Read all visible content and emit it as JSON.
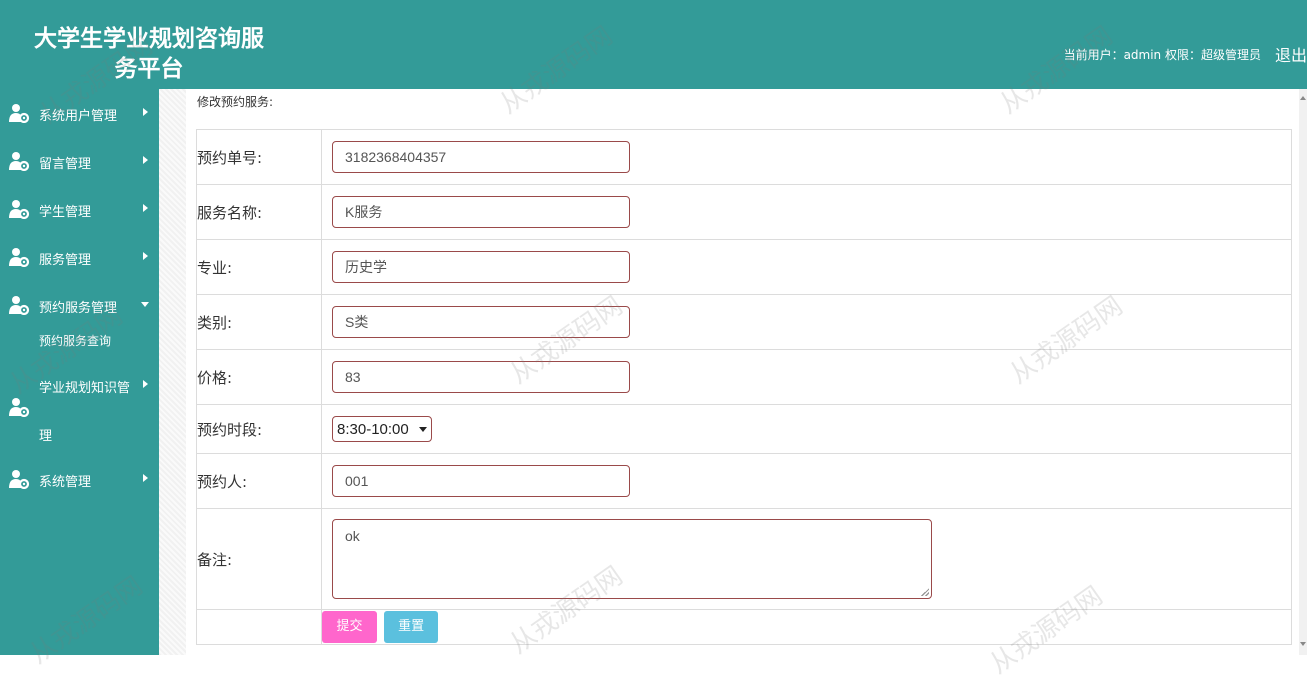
{
  "header": {
    "title_line1": "大学生学业规划咨询服",
    "title_line2": "务平台",
    "user_info": "当前用户：admin  权限：超级管理员",
    "logout": "退出"
  },
  "sidebar": {
    "items": [
      {
        "label": "系统用户管理",
        "icon": "user-gear-icon"
      },
      {
        "label": "留言管理",
        "icon": "user-gear-icon"
      },
      {
        "label": "学生管理",
        "icon": "user-gear-icon"
      },
      {
        "label": "服务管理",
        "icon": "user-gear-icon"
      },
      {
        "label": "预约服务管理",
        "icon": "user-gear-icon",
        "expanded": true,
        "children": [
          {
            "label": "预约服务查询"
          }
        ]
      },
      {
        "label": "学业规划知识管",
        "label_cont": "理",
        "icon": "user-gear-icon"
      },
      {
        "label": "系统管理",
        "icon": "user-gear-icon"
      }
    ]
  },
  "form": {
    "title": "修改预约服务:",
    "fields": {
      "order_no": {
        "label": "预约单号:",
        "value": "3182368404357"
      },
      "service_name": {
        "label": "服务名称:",
        "value": "K服务"
      },
      "major": {
        "label": "专业:",
        "value": "历史学"
      },
      "category": {
        "label": "类别:",
        "value": "S类"
      },
      "price": {
        "label": "价格:",
        "value": "83"
      },
      "time_slot": {
        "label": "预约时段:",
        "value": "8:30-10:00"
      },
      "booker": {
        "label": "预约人:",
        "value": "001"
      },
      "remark": {
        "label": "备注:",
        "value": "ok"
      }
    },
    "submit": "提交",
    "reset": "重置"
  },
  "watermark": "从戎源码网",
  "colors": {
    "header_bg": "#339b98",
    "sidebar_bg": "#339b98",
    "submit_bg": "#ff66cc",
    "reset_bg": "#5bc0de",
    "input_border": "#9a4a4a"
  }
}
